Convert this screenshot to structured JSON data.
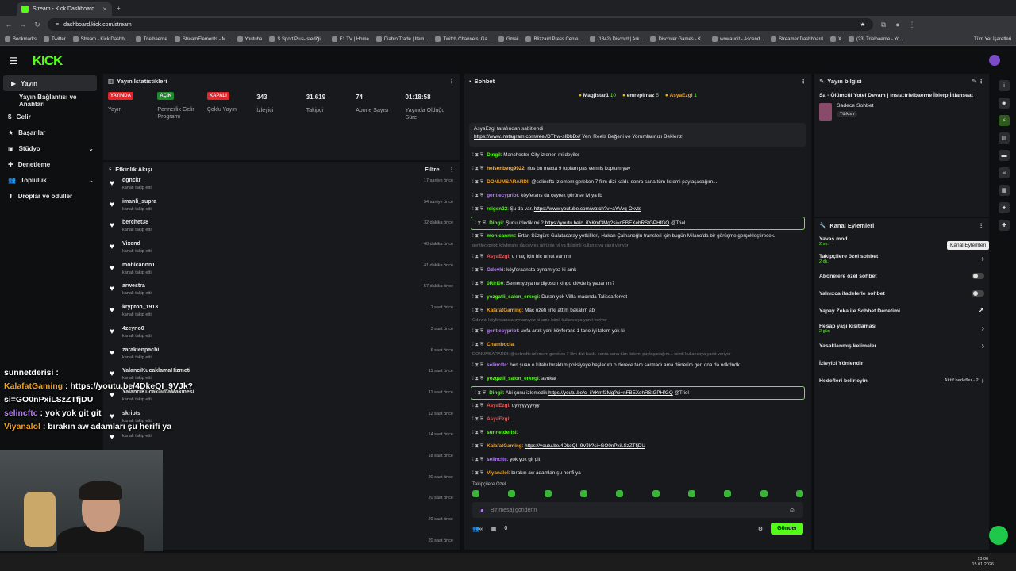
{
  "browser": {
    "tab_title": "Stream - Kick Dashboard",
    "url": "dashboard.kick.com/stream",
    "bookmarks": [
      "Bookmarks",
      "Twitter",
      "Stream - Kick Dashb...",
      "Trielbaerne",
      "StreamElements - M...",
      "Youtube",
      "S Sport Plus-İstediği...",
      "F1 TV | Home",
      "Diablo Trade | Item...",
      "Twitch Channels, Ga...",
      "Gmail",
      "Blizzard Press Cente...",
      "(1342) Discord | Ark...",
      "Discover Games - K...",
      "wowaudit - Ascend...",
      "Streamer Dashboard",
      "X",
      "(23) Trielbaerne - Yo..."
    ],
    "all_bookmarks": "Tüm Yer İşaretleri"
  },
  "app": {
    "logo": "KICK"
  },
  "nav": [
    {
      "label": "Yayın"
    },
    {
      "label": "Yayın Bağlantısı ve Anahtarı"
    },
    {
      "label": "Gelir"
    },
    {
      "label": "Başarılar"
    },
    {
      "label": "Stüdyo"
    },
    {
      "label": "Denetleme"
    },
    {
      "label": "Topluluk"
    },
    {
      "label": "Droplar ve ödüller"
    }
  ],
  "stats_panel": {
    "title": "Yayın İstatistikleri",
    "items": [
      {
        "badge": "YAYINDA",
        "badge_color": "#e3262b",
        "label": "Yayın"
      },
      {
        "badge": "AÇIK",
        "badge_color": "#1f8a2e",
        "label": "Partnerlik Gelir Programı"
      },
      {
        "badge": "KAPALI",
        "badge_color": "#e3262b",
        "label": "Çoklu Yayın"
      },
      {
        "value": "343",
        "label": "İzleyici"
      },
      {
        "value": "31.619",
        "label": "Takipçi"
      },
      {
        "value": "74",
        "label": "Abone Sayısı"
      },
      {
        "value": "01:18:58",
        "label": "Yayında Olduğu Süre"
      }
    ]
  },
  "activity": {
    "title": "Etkinlik Akışı",
    "filter": "Filtre",
    "events": [
      {
        "user": "dgnckr",
        "action": "kanalı takip etti",
        "time": "17 saniye önce"
      },
      {
        "user": "imanli_supra",
        "action": "kanalı takip etti",
        "time": "54 saniye önce"
      },
      {
        "user": "berchet38",
        "action": "kanalı takip etti",
        "time": "32 dakika önce"
      },
      {
        "user": "Vixend",
        "action": "kanalı takip etti",
        "time": "40 dakika önce"
      },
      {
        "user": "mohicannn1",
        "action": "kanalı takip etti",
        "time": "41 dakika önce"
      },
      {
        "user": "arwestra",
        "action": "kanalı takip etti",
        "time": "57 dakika önce"
      },
      {
        "user": "krypton_1913",
        "action": "kanalı takip etti",
        "time": "1 saat önce"
      },
      {
        "user": "4zeyno0",
        "action": "kanalı takip etti",
        "time": "3 saat önce"
      },
      {
        "user": "zarakienpachi",
        "action": "kanalı takip etti",
        "time": "6 saat önce"
      },
      {
        "user": "YalanciKucaklamaHizmeti",
        "action": "kanalı takip etti",
        "time": "11 saat önce"
      },
      {
        "user": "YalanciKucaklamaMakinesi",
        "action": "kanalı takip etti",
        "time": "11 saat önce"
      },
      {
        "user": "skripts",
        "action": "kanalı takip etti",
        "time": "12 saat önce"
      },
      {
        "user": "",
        "action": "kanalı takip etti",
        "time": "14 saat önce"
      },
      {
        "user": "",
        "action": "",
        "time": "18 saat önce"
      },
      {
        "user": "",
        "action": "",
        "time": "20 saat önce"
      },
      {
        "user": "",
        "action": "",
        "time": "20 saat önce"
      },
      {
        "user": "",
        "action": "",
        "time": "20 saat önce"
      },
      {
        "user": "",
        "action": "",
        "time": "20 saat önce"
      }
    ]
  },
  "chat": {
    "title": "Sohbet",
    "top": [
      {
        "user": "Magjistar1",
        "count": "10"
      },
      {
        "user": "emrepirnaz",
        "count": "5"
      },
      {
        "user": "AsyaEzgi",
        "count": "1"
      }
    ],
    "pinned_by": "AsyaEzgi tarafından sabitlendi",
    "pinned_link": "https://www.instagram.com/reel/DThw-sIDbDx/",
    "pinned_text": "Yeni Reels Beğeni ve Yorumlarınızı Bekleriz!",
    "messages": [
      {
        "user": "Dingil",
        "color": "#53fc18",
        "text": "Manchester City izlenen mi deyiler"
      },
      {
        "user": "heisenberg9922",
        "color": "#ffb347",
        "text": "rios bu maçta 9 toplam pas vermiş koptum yav"
      },
      {
        "user": "DONUMSARARDI",
        "color": "#f0a020",
        "text": "@selincftc izlemem gereken 7 film dizi kaldı. sonra sana tüm listemi paylaşacağım..."
      },
      {
        "user": "gentlecypriot",
        "color": "#b77cff",
        "text": "köyferans da çeyrek görürse iyi ya fb"
      },
      {
        "user": "reigen22",
        "color": "#53fc18",
        "text": "Şu da var.",
        "link": "https://www.youtube.com/watch?v=aYVvq-Okvts"
      },
      {
        "user": "Dingil",
        "color": "#53fc18",
        "text": "Şunu izledik mi ?",
        "link": "https://youtu.be/c_iIYKmf3Mg?si=nFBEXehRStGPHfGQ",
        "tail": "@Triel",
        "hl": true
      },
      {
        "user": "mohicannnt",
        "color": "#53fc18",
        "text": "Ertan Süzgün: Galatasaray yetkilileri, Hakan Çalhanoğlu transferi için bugün Milano'da bir görüşme gerçekleştirecek."
      },
      {
        "user": "AsyaEzgi",
        "color": "#e05a5a",
        "text": "o maç için hiç umut var mıı"
      },
      {
        "user": "Gdovki",
        "color": "#b77cff",
        "text": "köyferaansta oynamıyoz ki amk"
      },
      {
        "user": "0Riri00",
        "color": "#53fc18",
        "text": "Semenyoya ne diyosun kingo cityde iş yapar mı?"
      },
      {
        "user": "yozgatli_salon_erkegi",
        "color": "#53fc18",
        "text": "Duran yok Villla macında Talisca forvet"
      },
      {
        "user": "KalafatGaming",
        "color": "#f0a020",
        "text": "Maç özeti linki attım bakalım abi"
      },
      {
        "user": "gentlecypriot",
        "color": "#b77cff",
        "text": "uefa artık yeni köyferans 1 tane iyi takım yok ki"
      },
      {
        "user": "Chambocia",
        "color": "#f0a020",
        "text": ""
      },
      {
        "user": "selincftc",
        "color": "#b77cff",
        "text": "ben şuan o kitabı bıraktım polisiyeye başladım o derece tam sarmadı ama dönerim geri ona da ndkdndk"
      },
      {
        "user": "yozgatli_salon_erkegi",
        "color": "#53fc18",
        "text": "avukat"
      },
      {
        "user": "Dingil",
        "color": "#53fc18",
        "text": "Abi şunu izlemedik",
        "link": "https://youtu.be/c_iIYKmf3Mg?si=nFBEXehRStGPHfGQ",
        "tail": "@Triel",
        "hl": true
      },
      {
        "user": "AsyaEzgi",
        "color": "#e05a5a",
        "text": "oyyyyyyyyyy"
      },
      {
        "user": "AsyaEzgi",
        "color": "#e05a5a",
        "text": ""
      },
      {
        "user": "sunnetderisi",
        "color": "#53fc18",
        "text": ""
      },
      {
        "user": "KalafatGaming",
        "color": "#f0a020",
        "text": "",
        "link": "https://youtu.be/4DkeQI_9VJk?si=GO0nPxiLSzZTfjDU"
      },
      {
        "user": "selincftc",
        "color": "#b77cff",
        "text": "yok yok git git"
      },
      {
        "user": "Viyanalol",
        "color": "#f0a020",
        "text": "bırakın aw adamları şu herifi ya"
      }
    ],
    "sys1": "gentlecypriot: köyferans da çeyrek görürse iyi ya fb isimli kullanıcıya yanıt veriyor",
    "sys2": "Gdovki: köyferaansta oynamıyoz ki amk isimli kullanıcıya yanıt veriyor",
    "sys3": "DONUMSARARDI: @selincftc izlemem gereken 7 film dizi kaldı. sonra sana tüm listemi paylaşacağım... isimli kullanıcıya yanıt veriyor",
    "mode": "Takipçilere Özel",
    "placeholder": "Bir mesaj gönderin",
    "count": "0",
    "send": "Gönder"
  },
  "stream_info": {
    "title": "Yayın bilgisi",
    "stream_title": "Sa - Ölümcül Yotei Devam | insta:trielbaerne İblerp İltlanseat",
    "category": "Sadece Sohbet",
    "language": "Türkish"
  },
  "channel_actions": {
    "title": "Kanal Eylemleri",
    "tooltip": "Kanal Eylemleri",
    "items": [
      {
        "label": "Yavaş mod",
        "sub": "2 sn."
      },
      {
        "label": "Takipçilere özel sohbet",
        "sub": "2 dk."
      },
      {
        "label": "Abonelere özel sohbet"
      },
      {
        "label": "Yalnızca ifadelerle sohbet"
      },
      {
        "label": "Yapay Zeka ile Sohbet Denetimi"
      },
      {
        "label": "Hesap yaşı kısıtlaması",
        "sub": "2 gün"
      },
      {
        "label": "Yasaklanmış kelimeler"
      },
      {
        "label": "İzleyici Yönlendir"
      },
      {
        "label": "Hedefleri belirleyin",
        "extra": "Aktif hedefler - 2"
      }
    ]
  },
  "overlay_chat": [
    {
      "user": "sunnetderisi",
      "color": "#ffffff",
      "text": ""
    },
    {
      "user": "KalafatGaming",
      "color": "#f0a020",
      "text": "https://youtu.be/4DkeQI_9VJk?si=GO0nPxiLSzZTfjDU"
    },
    {
      "user": "selincftc",
      "color": "#b77cff",
      "text": "yok yok git git"
    },
    {
      "user": "Viyanalol",
      "color": "#f0a020",
      "text": "bırakın aw adamları şu herifi ya"
    }
  ],
  "taskbar": {
    "time": "13:06",
    "date": "15.01.2026"
  }
}
